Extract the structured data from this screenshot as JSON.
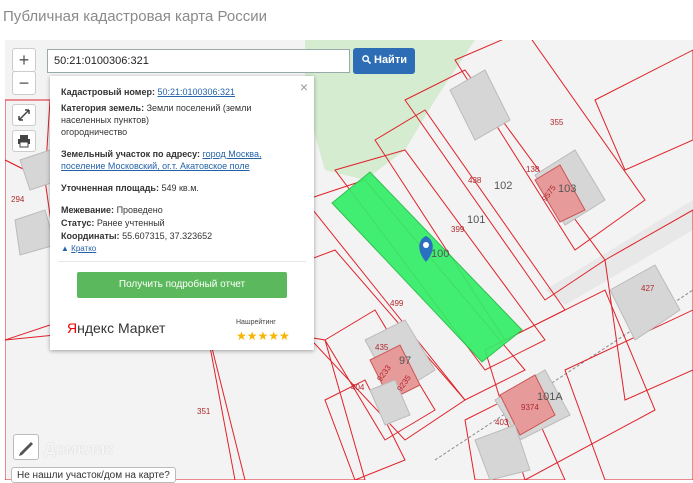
{
  "page": {
    "title": "Публичная кадастровая карта России"
  },
  "search": {
    "value": "50:21:0100306:321",
    "button_label": "Найти"
  },
  "zoom": {
    "plus": "+",
    "minus": "−"
  },
  "popup": {
    "close": "×",
    "cadastral_label": "Кадастровый номер:",
    "cadastral_value": "50:21:0100306:321",
    "category_label": "Категория земель:",
    "category_value": "Земли поселений (земли населенных пунктов)",
    "use_value": "огородничество",
    "address_label": "Земельный участок по адресу:",
    "address_value": "город Москва, поселение Московский, ог.т. Акатовское поле",
    "area_label": "Уточненная площадь:",
    "area_value": "549 кв.м.",
    "survey_label": "Межевание:",
    "survey_value": "Проведено",
    "status_label": "Статус:",
    "status_value": "Ранее учтенный",
    "coords_label": "Координаты:",
    "coords_value": "55.607315, 37.323652",
    "short_link": "Кратко",
    "report_button": "Получить подробный отчет",
    "market_logo_y": "Я",
    "market_logo_rest": "ндекс Маркет",
    "rating_label": "Нашрейтинг",
    "stars": "★★★★★"
  },
  "map_labels": {
    "l355": "355",
    "l438": "438",
    "l102": "102",
    "l101": "101",
    "l138": "138",
    "l103": "103",
    "l399": "399",
    "l100": "100",
    "l294": "294",
    "l427": "427",
    "l499": "499",
    "l435": "435",
    "l97": "97",
    "l404": "404",
    "l351": "351",
    "l101a": "101А",
    "l403": "403",
    "l9575": "9575",
    "l9233": "9233",
    "l9235": "9235",
    "l9374": "9374"
  },
  "watermark": "Домклик",
  "not_found": "Не нашли участок/дом на карте?",
  "colors": {
    "selected_parcel": "#33ee66",
    "parcel_border": "#e0222a",
    "accent": "#2c6db5",
    "report": "#5cb85c"
  }
}
